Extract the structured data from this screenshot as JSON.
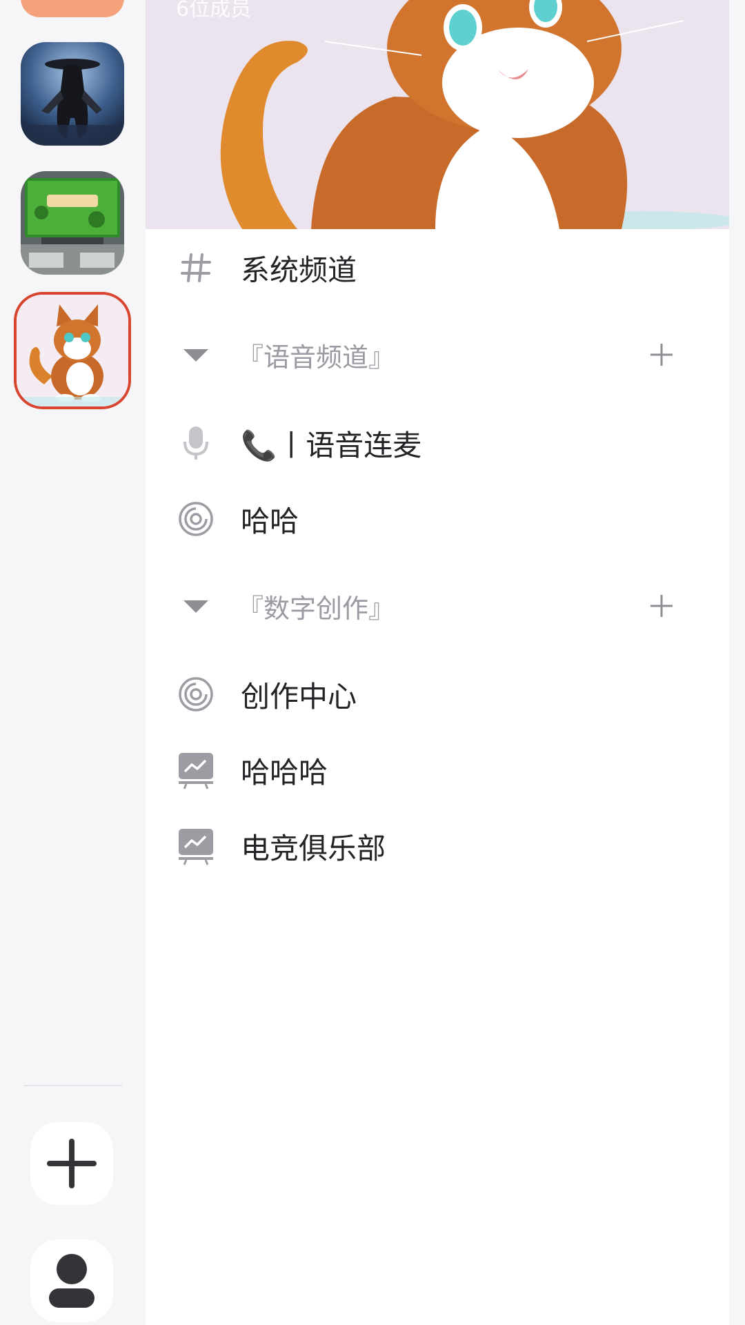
{
  "banner": {
    "subtitle": "6位成员"
  },
  "channels": {
    "system": {
      "label": "系统频道",
      "icon": "hash-icon"
    },
    "category_voice": {
      "label": "『语音频道』",
      "items": [
        {
          "label": "📞丨语音连麦",
          "icon": "microphone-icon"
        },
        {
          "label": "哈哈",
          "icon": "broadcast-icon"
        }
      ]
    },
    "category_digital": {
      "label": "『数字创作』",
      "items": [
        {
          "label": "创作中心",
          "icon": "broadcast-icon"
        },
        {
          "label": "哈哈哈",
          "icon": "presentation-board-icon"
        },
        {
          "label": "电竞俱乐部",
          "icon": "presentation-board-icon"
        }
      ]
    }
  },
  "colors": {
    "accent_orange": "#f5a27c",
    "active_border": "#d9442e",
    "text_primary": "#222326",
    "text_category": "#9a9ba2",
    "icon_gray": "#9c9da3"
  }
}
